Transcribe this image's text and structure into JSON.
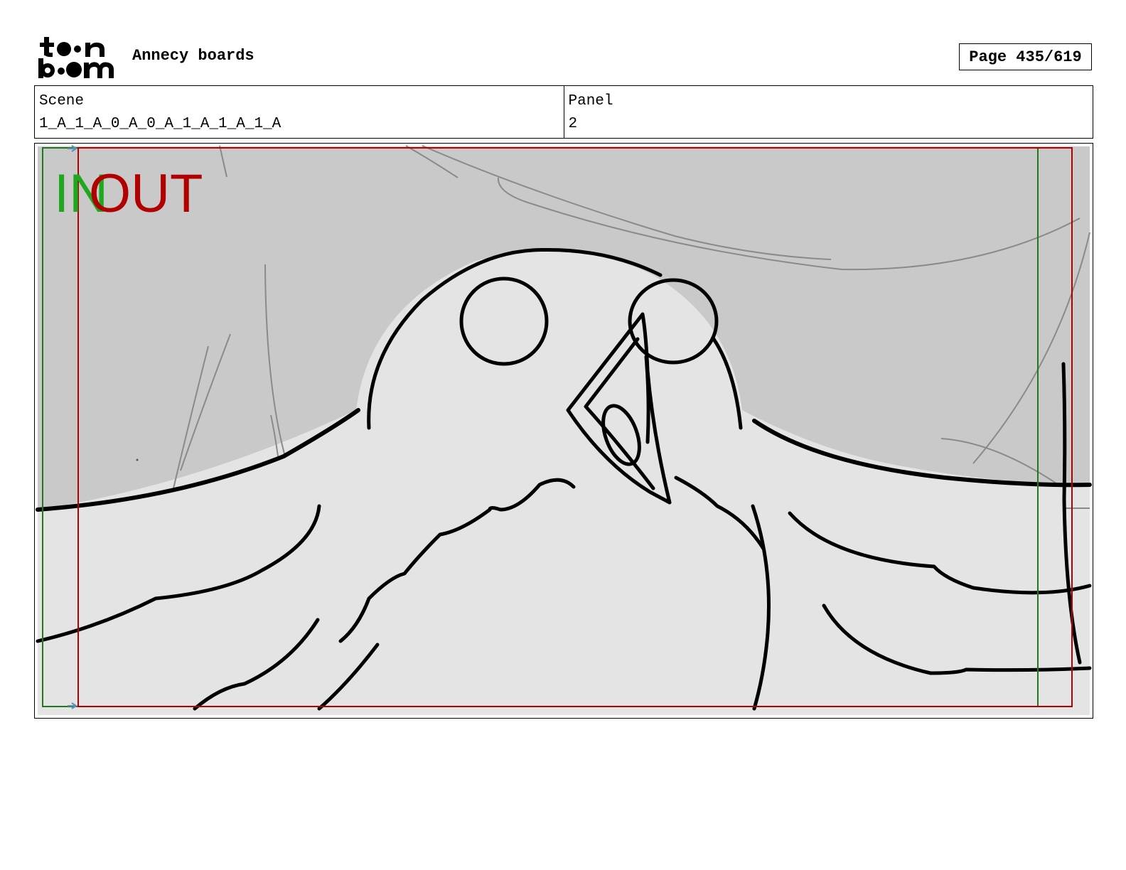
{
  "header": {
    "logo_text": "toon boom",
    "project_title": "Annecy boards",
    "page_label": "Page 435/619"
  },
  "info": {
    "scene_label": "Scene",
    "scene_value": "1_A_1_A_0_A_0_A_1_A_1_A_1_A",
    "panel_label": "Panel",
    "panel_value": "2"
  },
  "frame": {
    "in_label": "IN",
    "out_label": "OUT",
    "in_color": "#1fa81f",
    "out_color": "#b00000"
  }
}
